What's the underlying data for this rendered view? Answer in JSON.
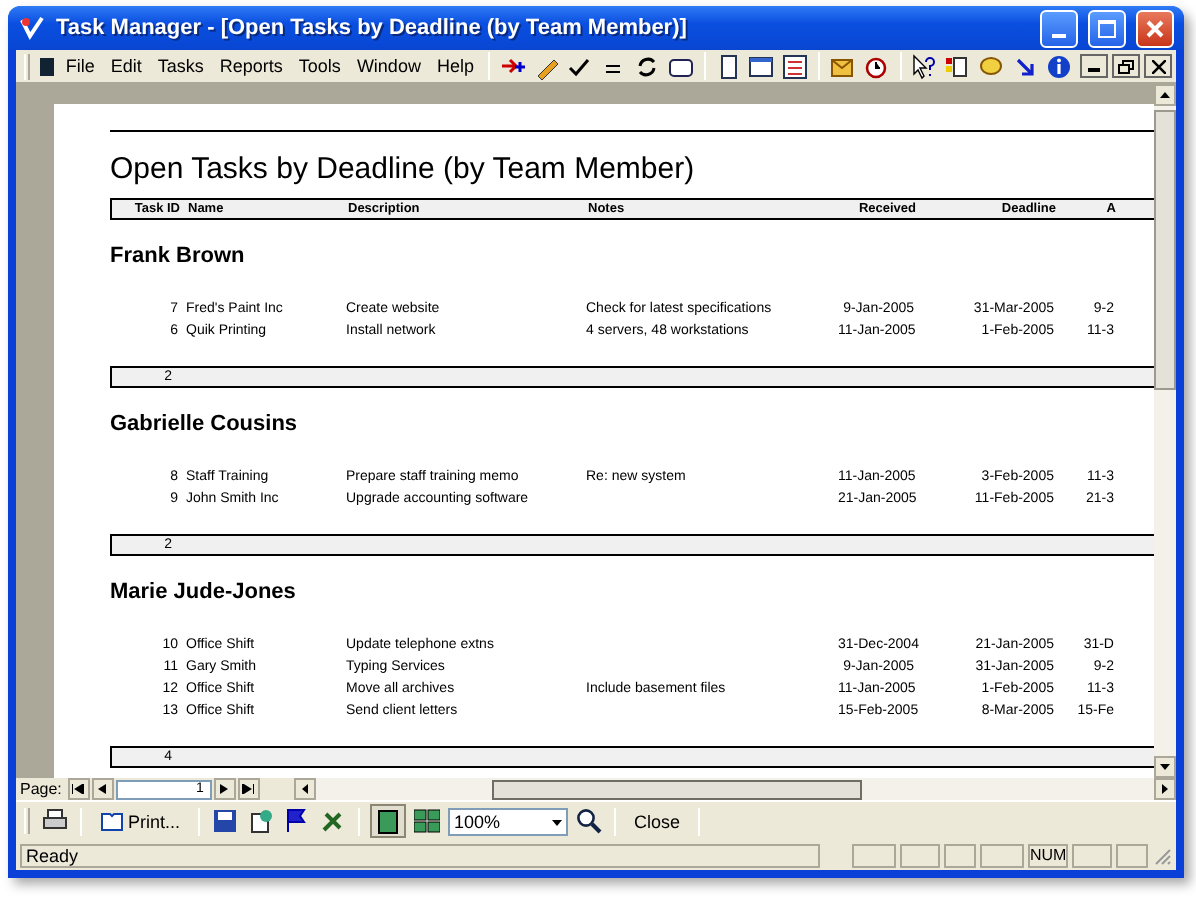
{
  "window": {
    "title": "Task Manager - [Open Tasks by Deadline (by Team Member)]"
  },
  "menu": [
    "File",
    "Edit",
    "Tasks",
    "Reports",
    "Tools",
    "Window",
    "Help"
  ],
  "report": {
    "title": "Open Tasks by Deadline (by Team Member)",
    "columns": [
      "Task ID",
      "Name",
      "Description",
      "Notes",
      "Received",
      "Deadline",
      "A"
    ],
    "groups": [
      {
        "name": "Frank Brown",
        "count": "2",
        "rows": [
          [
            "7",
            "Fred's Paint Inc",
            "Create website",
            "Check for latest specifications",
            "9-Jan-2005",
            "31-Mar-2005",
            "9-2"
          ],
          [
            "6",
            "Quik Printing",
            "Install network",
            "4 servers, 48 workstations",
            "11-Jan-2005",
            "1-Feb-2005",
            "11-3"
          ]
        ]
      },
      {
        "name": "Gabrielle Cousins",
        "count": "2",
        "rows": [
          [
            "8",
            "Staff Training",
            "Prepare staff training memo",
            "Re: new system",
            "11-Jan-2005",
            "3-Feb-2005",
            "11-3"
          ],
          [
            "9",
            "John Smith Inc",
            "Upgrade accounting software",
            "",
            "21-Jan-2005",
            "11-Feb-2005",
            "21-3"
          ]
        ]
      },
      {
        "name": "Marie Jude-Jones",
        "count": "4",
        "rows": [
          [
            "10",
            "Office Shift",
            "Update telephone extns",
            "",
            "31-Dec-2004",
            "21-Jan-2005",
            "31-D"
          ],
          [
            "11",
            "Gary Smith",
            "Typing Services",
            "",
            "9-Jan-2005",
            "31-Jan-2005",
            "9-2"
          ],
          [
            "12",
            "Office Shift",
            "Move all archives",
            "Include basement files",
            "11-Jan-2005",
            "1-Feb-2005",
            "11-3"
          ],
          [
            "13",
            "Office Shift",
            "Send client letters",
            "",
            "15-Feb-2005",
            "8-Mar-2005",
            "15-Fe"
          ]
        ]
      }
    ]
  },
  "pager": {
    "label": "Page:",
    "value": "1"
  },
  "preview_toolbar": {
    "print": "Print...",
    "zoom": "100%",
    "close": "Close"
  },
  "status_bar": {
    "text": "Ready",
    "indicator": "NUM"
  }
}
